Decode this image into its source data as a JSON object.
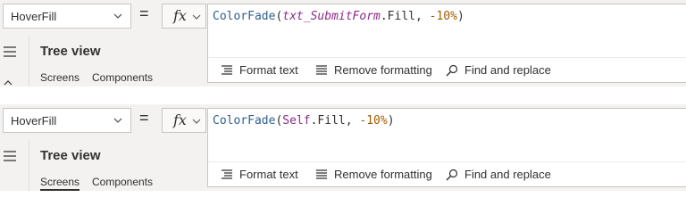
{
  "panels": [
    {
      "property": "HoverFill",
      "equals": "=",
      "fx": "fx",
      "formula": {
        "fn": "ColorFade",
        "open": "(",
        "arg_ident": "txt_SubmitForm",
        "arg_prop": ".Fill, ",
        "arg_num": "-10%",
        "close": ")"
      },
      "toolbar": {
        "format_text": "Format text",
        "remove_formatting": "Remove formatting",
        "find_replace": "Find and replace"
      },
      "tree_view": {
        "title": "Tree view",
        "tabs": [
          "Screens",
          "Components"
        ]
      }
    },
    {
      "property": "HoverFill",
      "equals": "=",
      "fx": "fx",
      "formula": {
        "fn": "ColorFade",
        "open": "(",
        "arg_ident": "Self",
        "arg_prop": ".Fill, ",
        "arg_num": "-10%",
        "close": ")"
      },
      "toolbar": {
        "format_text": "Format text",
        "remove_formatting": "Remove formatting",
        "find_replace": "Find and replace"
      },
      "tree_view": {
        "title": "Tree view",
        "tabs": [
          "Screens",
          "Components"
        ]
      }
    }
  ],
  "colors": {
    "function": "#2f5f8a",
    "identifier": "#8a2b8a",
    "number": "#a25b00",
    "chrome_bg": "#f3f2f1"
  },
  "icons": [
    "chevron-down-icon",
    "fx-icon",
    "format-text-icon",
    "remove-formatting-icon",
    "search-icon",
    "hamburger-icon",
    "chevron-left-icon"
  ]
}
